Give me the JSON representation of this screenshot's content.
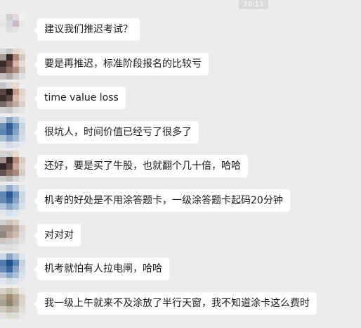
{
  "chat": {
    "timestamp": "10:13",
    "messages": [
      {
        "text": "建议我们推迟考试？",
        "avatar": [
          "#e9e9e9",
          "#cfcfcf",
          "#e2d9e0",
          "#f0f0f0",
          "#ececec",
          "#e6e6e6",
          "#d8d8d8",
          "#c9b9c6",
          "#e9e9e9",
          "#ececec",
          "#ececec",
          "#dcdcdc",
          "#e4e4e4",
          "#ececec",
          "#ececec",
          "#ececec",
          "#ececec",
          "#ececec",
          "#ececec",
          "#ececec",
          "#ececec",
          "#ececec",
          "#ececec",
          "#ececec",
          "#ececec"
        ]
      },
      {
        "text": "要是再推迟，标准阶段报名的比较亏",
        "avatar": [
          "#d8d8d8",
          "#c7c7c7",
          "#ead8cc",
          "#e8e2dc",
          "#ececec",
          "#a79a92",
          "#3a2a28",
          "#b0877a",
          "#d8c7bf",
          "#ececec",
          "#3a2d2c",
          "#6b4e4a",
          "#d6b3a5",
          "#e4dcd8",
          "#ececec",
          "#5b4845",
          "#8e6f68",
          "#a98c82",
          "#d0c8c4",
          "#ececec",
          "#c4bcb8",
          "#b4aaa6",
          "#cfcbc9",
          "#e2e2e2",
          "#ececec"
        ]
      },
      {
        "text": "time value loss",
        "avatar": [
          "#c6c6c6",
          "#d7d7d7",
          "#ead9d0",
          "#ececec",
          "#ececec",
          "#5a4744",
          "#2a1f1f",
          "#c39b8d",
          "#e3d2ca",
          "#ececec",
          "#3b2f2e",
          "#5b4542",
          "#d9b8aa",
          "#e6ddd8",
          "#ececec",
          "#7a6a67",
          "#a18d87",
          "#bfaaa2",
          "#d7d0cc",
          "#ececec",
          "#cfcfcf",
          "#c7c7c7",
          "#dddddd",
          "#e6e6e6",
          "#ececec"
        ]
      },
      {
        "text": "很坑人，时间价值已经亏了很多了",
        "avatar": [
          "#c9d5e2",
          "#8ca6c3",
          "#b7c6d8",
          "#dde4ec",
          "#ececec",
          "#6a8eb7",
          "#2e5c93",
          "#6f94bf",
          "#c7d3e2",
          "#ececec",
          "#5c84b1",
          "#3b6aa1",
          "#84a4c8",
          "#ccd7e4",
          "#ececec",
          "#a9bdd3",
          "#7f9fc3",
          "#a4bad3",
          "#d6dfe9",
          "#ececec",
          "#dfe5ec",
          "#d2dbe6",
          "#dbe2ea",
          "#e6e9ec",
          "#ececec"
        ]
      },
      {
        "text": "还好，要是买了牛股，也就翻个几十倍，哈哈",
        "avatar": [
          "#d3d3d3",
          "#cdcdcd",
          "#ead8cc",
          "#ececec",
          "#ececec",
          "#9e918b",
          "#3b2b29",
          "#b38a7c",
          "#dccbc2",
          "#ececec",
          "#32272a",
          "#5e4744",
          "#caa597",
          "#e2d8d2",
          "#ececec",
          "#675553",
          "#8f736c",
          "#a58a80",
          "#d4ccc8",
          "#ececec",
          "#cacaca",
          "#bcbcbc",
          "#d6d6d6",
          "#e4e4e4",
          "#ececec"
        ]
      },
      {
        "text": "机考的好处是不用涂答题卡，一级涂答题卡起码20分钟",
        "avatar": [
          "#c6d3e0",
          "#93abc6",
          "#bccbdb",
          "#e0e6ec",
          "#ececec",
          "#5f87b3",
          "#2a5892",
          "#6d93bf",
          "#cad6e4",
          "#ececec",
          "#6589b3",
          "#3f6ca2",
          "#86a6c9",
          "#cfd9e5",
          "#ececec",
          "#b1c3d7",
          "#8aa7c7",
          "#a9bfd6",
          "#d9e1ea",
          "#ececec",
          "#e2e7ec",
          "#d6dee8",
          "#dee4eb",
          "#e8eaec",
          "#ececec"
        ]
      },
      {
        "text": "对对对",
        "avatar": [
          "#cfcfcf",
          "#c9c2bd",
          "#d9cfc8",
          "#e9e9e9",
          "#ececec",
          "#9d948f",
          "#a49287",
          "#c1aea3",
          "#dcd5d1",
          "#ececec",
          "#8f8783",
          "#b7a59b",
          "#cdbbb1",
          "#e0dcda",
          "#ececec",
          "#c8c5c3",
          "#d2ccc9",
          "#d9d4d1",
          "#e5e4e3",
          "#ececec",
          "#e0e0e0",
          "#dddddd",
          "#e4e4e4",
          "#e9e9e9",
          "#ececec"
        ]
      },
      {
        "text": "机考就怕有人拉电闸，哈哈",
        "avatar": [
          "#cad6e2",
          "#8da7c4",
          "#b6c6d8",
          "#dee5ec",
          "#ececec",
          "#4f7aab",
          "#23508c",
          "#5f88b8",
          "#c4d2e2",
          "#ececec",
          "#678bb4",
          "#3c69a0",
          "#87a6c9",
          "#cfd9e5",
          "#ececec",
          "#b3c4d7",
          "#8ba8c8",
          "#aac0d7",
          "#d9e1ea",
          "#ececec",
          "#e1e6ec",
          "#d5dde7",
          "#dde3ea",
          "#e7e9ec",
          "#ececec"
        ]
      },
      {
        "text": "我一级上午就来不及涂放了半行天窗，我不知道涂卡这么费时",
        "avatar": [
          "#d6d0c6",
          "#c9c0b2",
          "#d8d1c6",
          "#e8e6e2",
          "#ececec",
          "#b8ac98",
          "#9c8b72",
          "#b9a995",
          "#d8d2c9",
          "#ececec",
          "#aaa08f",
          "#8f826f",
          "#b2a796",
          "#d7d2ca",
          "#ececec",
          "#cdc7bd",
          "#bdb4a7",
          "#c8c0b5",
          "#e0ddd8",
          "#ececec",
          "#e4e2de",
          "#dcd8d2",
          "#e0ddd8",
          "#e9e8e6",
          "#ececec"
        ]
      }
    ]
  }
}
